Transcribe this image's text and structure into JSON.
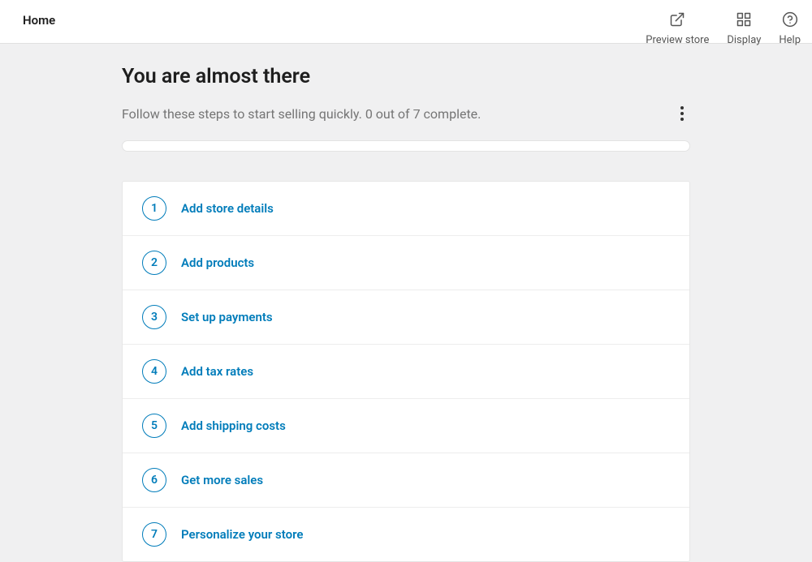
{
  "header": {
    "title": "Home",
    "actions": {
      "preview": "Preview store",
      "display": "Display",
      "help": "Help"
    }
  },
  "main": {
    "heading": "You are almost there",
    "subtext": "Follow these steps to start selling quickly. 0 out of 7 complete.",
    "steps": [
      {
        "num": "1",
        "label": "Add store details"
      },
      {
        "num": "2",
        "label": "Add products"
      },
      {
        "num": "3",
        "label": "Set up payments"
      },
      {
        "num": "4",
        "label": "Add tax rates"
      },
      {
        "num": "5",
        "label": "Add shipping costs"
      },
      {
        "num": "6",
        "label": "Get more sales"
      },
      {
        "num": "7",
        "label": "Personalize your store"
      }
    ]
  }
}
